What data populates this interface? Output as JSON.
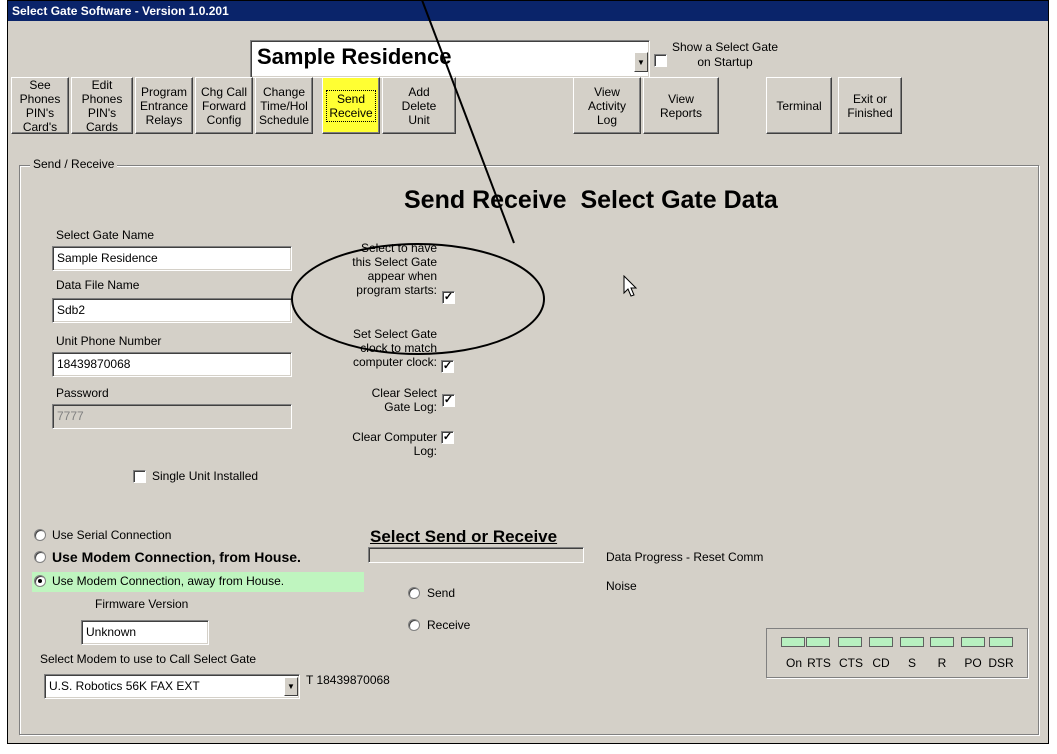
{
  "window": {
    "title": "Select Gate Software - Version 1.0.201"
  },
  "header": {
    "gate_select": "Sample Residence",
    "show_on_startup_label": "Show a Select Gate\non Startup"
  },
  "toolbar": [
    {
      "label": "See\nPhones\nPIN's Card's"
    },
    {
      "label": "Edit\nPhones\nPIN's Cards"
    },
    {
      "label": "Program\nEntrance\nRelays"
    },
    {
      "label": "Chg Call\nForward\nConfig"
    },
    {
      "label": "Change\nTime/Hol\nSchedule"
    },
    {
      "label": "Send\nReceive"
    },
    {
      "label": "Add\nDelete\nUnit"
    },
    {
      "label": "View\nActivity\nLog"
    },
    {
      "label": "View\nReports"
    },
    {
      "label": "Terminal"
    },
    {
      "label": "Exit or\nFinished"
    }
  ],
  "main": {
    "group_title": "Send / Receive",
    "heading": "Send Receive  Select Gate Data",
    "gate_name_label": "Select Gate Name",
    "gate_name_value": "Sample Residence",
    "data_file_label": "Data File Name",
    "data_file_value": "Sdb2",
    "phone_label": "Unit Phone Number",
    "phone_value": "18439870068",
    "password_label": "Password",
    "password_value": "7777",
    "single_unit_label": "Single Unit Installed",
    "opt_startup_label": "Select to have\nthis Select Gate\nappear when\nprogram starts:",
    "opt_clock_label": "Set Select Gate\nclock to match\ncomputer clock:",
    "opt_clear_gate_label": "Clear Select\nGate Log:",
    "opt_clear_computer_label": "Clear Computer\nLog:",
    "conn_serial": "Use Serial Connection",
    "conn_modem_house": "Use Modem Connection, from House.",
    "conn_modem_away": "Use Modem Connection, away from House.",
    "firmware_label": "Firmware Version",
    "firmware_value": "Unknown",
    "modem_label": "Select Modem to use to Call Select Gate",
    "modem_value": "U.S. Robotics 56K FAX EXT",
    "modem_number": "T 18439870068",
    "send_receive_heading": "Select Send or Receive",
    "send_label": "Send",
    "receive_label": "Receive",
    "progress_label": "Data Progress - Reset Comm",
    "noise_label": "Noise",
    "progress_value": 0,
    "leds": [
      "On",
      "RTS",
      "CTS",
      "CD",
      "S",
      "R",
      "PO",
      "DSR"
    ]
  },
  "colors": {
    "titlebar": "#0a246a",
    "active_button": "#ffff33",
    "highlight_row": "#bff5bf",
    "led": "#b8f0c0"
  }
}
